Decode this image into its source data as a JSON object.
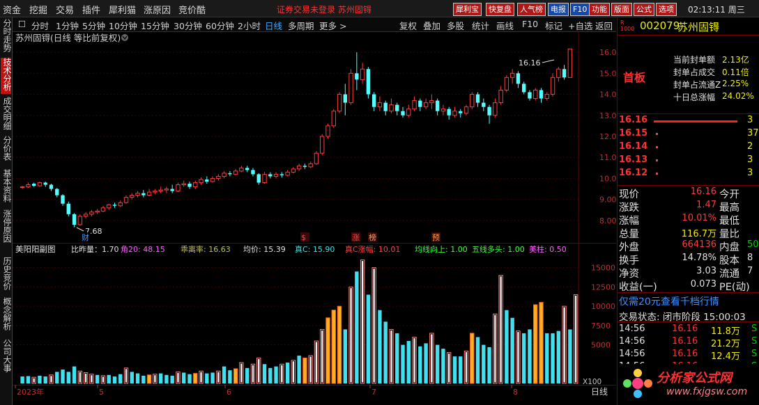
{
  "menu": {
    "items": [
      "资金",
      "挖掘",
      "交易",
      "插件",
      "犀利猫",
      "涨原因",
      "竞价酷"
    ],
    "alert": "证券交易未登录 苏州固锝",
    "tools": [
      "犀利宝",
      "快复盘",
      "人气榜",
      "电报",
      "F10",
      "功能",
      "版面",
      "公式",
      "选项"
    ],
    "clock": "02:13:11 周三"
  },
  "leftnav": [
    "分时走势",
    "技术分析",
    "成交明细",
    "分价表",
    "基本资料",
    "涨停原因",
    "历史竞价",
    "概念解析",
    "公司大事"
  ],
  "periods": [
    "分时",
    "1分钟",
    "5分钟",
    "10分钟",
    "15分钟",
    "30分钟",
    "60分钟",
    "2小时",
    "日线",
    "多周期",
    "更多 >"
  ],
  "active_period": "日线",
  "toolbar_right": [
    "复权",
    "叠加",
    "多股",
    "统计",
    "画线",
    "F10",
    "标记",
    "+自选",
    "返回"
  ],
  "chart": {
    "title": "苏州固锝(日线 等比前复权)",
    "high_label": "16.16",
    "low_label": "7.68",
    "price_ticks": [
      "16.00",
      "15.00",
      "14.00",
      "13.00",
      "12.00",
      "11.00",
      "10.00",
      "9.00",
      "8.00"
    ],
    "markers": [
      {
        "text": "财",
        "color": "#40a0ff"
      },
      {
        "text": "$",
        "color": "#ff4040"
      },
      {
        "text": "涨",
        "color": "#ff4040"
      },
      {
        "text": "榜",
        "color": "#ffa040"
      },
      {
        "text": "预",
        "color": "#ffa040"
      }
    ],
    "indicator_name": "美阳阳副图",
    "indicators": [
      {
        "text": "比昨量：1.70",
        "color": "#e0e0e0"
      },
      {
        "text": "角20: 48.15",
        "color": "#ff60ff"
      },
      {
        "text": "乖离率: 16.63",
        "color": "#c0c060"
      },
      {
        "text": "均价: 15.39",
        "color": "#e0e0e0"
      },
      {
        "text": "真C: 15.90",
        "color": "#40e0e0"
      },
      {
        "text": "真C涨幅: 10.01",
        "color": "#ff4040"
      },
      {
        "text": "均线向上: 1.00",
        "color": "#40ff40"
      },
      {
        "text": "五线多头: 1.00",
        "color": "#40ff40"
      },
      {
        "text": "美柱: 0.50",
        "color": "#ff60ff"
      }
    ],
    "volume_ticks": [
      "15000",
      "12500",
      "10000",
      "7500",
      "5000"
    ],
    "volume_unit": "X100",
    "date_labels": [
      "2023年",
      "5",
      "6",
      "7",
      "8"
    ],
    "date_right": "日线"
  },
  "chart_data": {
    "type": "candlestick",
    "price_ylim": [
      7.5,
      16.3
    ],
    "candles": [
      [
        9.6,
        9.6,
        9.5,
        9.65
      ],
      [
        9.6,
        9.7,
        9.55,
        9.8
      ],
      [
        9.75,
        9.65,
        9.6,
        9.8
      ],
      [
        9.65,
        9.8,
        9.6,
        9.85
      ],
      [
        9.8,
        9.7,
        9.6,
        9.85
      ],
      [
        9.7,
        9.5,
        9.4,
        9.75
      ],
      [
        9.5,
        9.2,
        9.1,
        9.55
      ],
      [
        9.2,
        8.8,
        8.7,
        9.25
      ],
      [
        8.8,
        8.3,
        8.2,
        8.9
      ],
      [
        8.3,
        7.8,
        7.68,
        8.35
      ],
      [
        7.8,
        8.2,
        7.75,
        8.3
      ],
      [
        8.2,
        8.3,
        8.1,
        8.4
      ],
      [
        8.3,
        8.4,
        8.2,
        8.5
      ],
      [
        8.4,
        8.45,
        8.3,
        8.55
      ],
      [
        8.45,
        8.6,
        8.4,
        8.7
      ],
      [
        8.6,
        8.75,
        8.5,
        8.8
      ],
      [
        8.75,
        8.7,
        8.6,
        8.85
      ],
      [
        8.7,
        8.85,
        8.65,
        8.95
      ],
      [
        8.85,
        9.1,
        8.8,
        9.2
      ],
      [
        9.1,
        9.2,
        9.0,
        9.3
      ],
      [
        9.2,
        9.3,
        9.1,
        9.4
      ],
      [
        9.3,
        9.2,
        9.1,
        9.45
      ],
      [
        9.2,
        9.35,
        9.15,
        9.5
      ],
      [
        9.35,
        9.4,
        9.25,
        9.5
      ],
      [
        9.4,
        9.45,
        9.3,
        9.6
      ],
      [
        9.45,
        9.5,
        9.3,
        9.6
      ],
      [
        9.5,
        9.4,
        9.3,
        9.7
      ],
      [
        9.4,
        9.7,
        9.35,
        9.8
      ],
      [
        9.7,
        9.75,
        9.6,
        9.9
      ],
      [
        9.75,
        9.6,
        9.5,
        9.85
      ],
      [
        9.6,
        9.8,
        9.5,
        9.9
      ],
      [
        9.8,
        9.95,
        9.7,
        10.05
      ],
      [
        9.95,
        9.85,
        9.75,
        10.1
      ],
      [
        9.85,
        10.0,
        9.8,
        10.1
      ],
      [
        10.0,
        10.1,
        9.9,
        10.2
      ],
      [
        10.1,
        10.25,
        10.0,
        10.35
      ],
      [
        10.25,
        10.2,
        10.1,
        10.35
      ],
      [
        10.2,
        10.35,
        10.15,
        10.45
      ],
      [
        10.35,
        10.5,
        10.3,
        10.6
      ],
      [
        10.5,
        10.4,
        10.3,
        10.6
      ],
      [
        10.4,
        10.2,
        10.1,
        10.5
      ],
      [
        10.2,
        9.8,
        9.7,
        10.25
      ],
      [
        9.8,
        10.2,
        9.75,
        10.3
      ],
      [
        10.2,
        10.1,
        10.0,
        10.3
      ],
      [
        10.1,
        10.2,
        10.0,
        10.3
      ],
      [
        10.2,
        10.15,
        10.05,
        10.3
      ],
      [
        10.15,
        10.3,
        10.1,
        10.4
      ],
      [
        10.3,
        10.45,
        10.25,
        10.55
      ],
      [
        10.45,
        10.6,
        10.35,
        10.7
      ],
      [
        10.6,
        10.55,
        10.45,
        10.7
      ],
      [
        10.55,
        10.7,
        10.5,
        10.8
      ],
      [
        10.7,
        11.2,
        10.65,
        11.3
      ],
      [
        11.2,
        12.0,
        11.1,
        12.1
      ],
      [
        12.0,
        12.5,
        11.9,
        12.6
      ],
      [
        12.5,
        13.2,
        12.4,
        13.3
      ],
      [
        13.2,
        14.0,
        13.1,
        14.1
      ],
      [
        14.0,
        13.6,
        13.0,
        14.5
      ],
      [
        13.6,
        15.0,
        13.5,
        15.2
      ],
      [
        15.0,
        14.7,
        14.2,
        16.0
      ],
      [
        14.7,
        15.2,
        14.5,
        15.5
      ],
      [
        15.2,
        14.0,
        13.8,
        15.3
      ],
      [
        14.0,
        13.4,
        13.2,
        14.1
      ],
      [
        13.4,
        13.6,
        13.2,
        13.9
      ],
      [
        13.6,
        13.2,
        13.0,
        13.7
      ],
      [
        13.2,
        13.5,
        13.1,
        13.8
      ],
      [
        13.5,
        13.2,
        13.0,
        13.6
      ],
      [
        13.2,
        13.0,
        12.9,
        13.4
      ],
      [
        13.0,
        13.3,
        12.9,
        13.5
      ],
      [
        13.3,
        13.7,
        13.2,
        13.9
      ],
      [
        13.7,
        13.4,
        13.2,
        13.8
      ],
      [
        13.4,
        13.6,
        13.3,
        13.8
      ],
      [
        13.6,
        13.7,
        13.3,
        14.0
      ],
      [
        13.7,
        13.2,
        13.0,
        13.8
      ],
      [
        13.2,
        13.3,
        13.0,
        13.5
      ],
      [
        13.3,
        13.0,
        12.8,
        13.4
      ],
      [
        13.0,
        13.2,
        12.9,
        13.4
      ],
      [
        13.2,
        13.1,
        12.9,
        13.3
      ],
      [
        13.1,
        13.4,
        13.0,
        13.5
      ],
      [
        13.4,
        14.0,
        13.3,
        14.1
      ],
      [
        14.0,
        13.6,
        13.4,
        14.1
      ],
      [
        13.6,
        13.4,
        13.2,
        13.8
      ],
      [
        13.4,
        13.0,
        12.6,
        13.5
      ],
      [
        13.0,
        13.6,
        12.9,
        13.8
      ],
      [
        13.6,
        14.2,
        13.5,
        14.4
      ],
      [
        14.2,
        14.8,
        14.1,
        14.9
      ],
      [
        14.8,
        15.0,
        14.5,
        15.2
      ],
      [
        15.0,
        14.5,
        14.3,
        15.1
      ],
      [
        14.5,
        14.1,
        14.0,
        14.6
      ],
      [
        14.1,
        13.8,
        13.7,
        14.2
      ],
      [
        13.8,
        14.2,
        13.7,
        14.3
      ],
      [
        14.2,
        13.8,
        13.6,
        14.3
      ],
      [
        13.8,
        14.0,
        13.7,
        14.1
      ],
      [
        14.0,
        14.8,
        13.9,
        15.0
      ],
      [
        14.8,
        15.2,
        14.6,
        15.3
      ],
      [
        15.2,
        14.8,
        14.7,
        15.4
      ],
      [
        14.8,
        16.16,
        14.8,
        16.16
      ]
    ],
    "volume_ylim": [
      0,
      16500
    ],
    "volumes": [
      [
        900,
        "c"
      ],
      [
        950,
        "c"
      ],
      [
        800,
        "w"
      ],
      [
        1000,
        "c"
      ],
      [
        900,
        "c"
      ],
      [
        1100,
        "w"
      ],
      [
        1500,
        "c"
      ],
      [
        1800,
        "c"
      ],
      [
        1500,
        "c"
      ],
      [
        2200,
        "c"
      ],
      [
        1600,
        "w"
      ],
      [
        1400,
        "w"
      ],
      [
        1200,
        "w"
      ],
      [
        1100,
        "c"
      ],
      [
        1000,
        "w"
      ],
      [
        1100,
        "c"
      ],
      [
        900,
        "c"
      ],
      [
        1200,
        "c"
      ],
      [
        2000,
        "w"
      ],
      [
        1500,
        "c"
      ],
      [
        1300,
        "c"
      ],
      [
        1000,
        "c"
      ],
      [
        1100,
        "o"
      ],
      [
        1200,
        "w"
      ],
      [
        1300,
        "c"
      ],
      [
        1100,
        "c"
      ],
      [
        1000,
        "c"
      ],
      [
        1500,
        "w"
      ],
      [
        1400,
        "c"
      ],
      [
        1200,
        "c"
      ],
      [
        1300,
        "o"
      ],
      [
        1600,
        "w"
      ],
      [
        1300,
        "c"
      ],
      [
        1400,
        "c"
      ],
      [
        1600,
        "w"
      ],
      [
        2200,
        "c"
      ],
      [
        1700,
        "c"
      ],
      [
        1900,
        "o"
      ],
      [
        2700,
        "w"
      ],
      [
        2000,
        "c"
      ],
      [
        2500,
        "w"
      ],
      [
        3300,
        "w"
      ],
      [
        2500,
        "c"
      ],
      [
        2000,
        "c"
      ],
      [
        2200,
        "c"
      ],
      [
        2500,
        "w"
      ],
      [
        2700,
        "c"
      ],
      [
        3000,
        "w"
      ],
      [
        3600,
        "c"
      ],
      [
        3300,
        "o"
      ],
      [
        3600,
        "w"
      ],
      [
        5500,
        "w"
      ],
      [
        7000,
        "w"
      ],
      [
        8500,
        "o"
      ],
      [
        9500,
        "o"
      ],
      [
        10000,
        "o"
      ],
      [
        7000,
        "c"
      ],
      [
        12500,
        "w"
      ],
      [
        14500,
        "c"
      ],
      [
        16000,
        "w"
      ],
      [
        11500,
        "c"
      ],
      [
        15000,
        "w"
      ],
      [
        9500,
        "c"
      ],
      [
        8000,
        "c"
      ],
      [
        7000,
        "w"
      ],
      [
        6500,
        "c"
      ],
      [
        5000,
        "c"
      ],
      [
        5500,
        "c"
      ],
      [
        6000,
        "w"
      ],
      [
        4800,
        "c"
      ],
      [
        5200,
        "c"
      ],
      [
        6500,
        "w"
      ],
      [
        5000,
        "c"
      ],
      [
        4500,
        "c"
      ],
      [
        4000,
        "w"
      ],
      [
        3500,
        "c"
      ],
      [
        3500,
        "c"
      ],
      [
        4200,
        "w"
      ],
      [
        6500,
        "o"
      ],
      [
        6000,
        "c"
      ],
      [
        5000,
        "c"
      ],
      [
        4700,
        "c"
      ],
      [
        9000,
        "w"
      ],
      [
        14000,
        "w"
      ],
      [
        9500,
        "c"
      ],
      [
        8500,
        "c"
      ],
      [
        6800,
        "w"
      ],
      [
        6500,
        "c"
      ],
      [
        7000,
        "c"
      ],
      [
        10200,
        "o"
      ],
      [
        10500,
        "o"
      ],
      [
        6500,
        "c"
      ],
      [
        6500,
        "c"
      ],
      [
        6800,
        "c"
      ],
      [
        10000,
        "w"
      ],
      [
        7000,
        "c"
      ],
      [
        11500,
        "w"
      ]
    ]
  },
  "stock": {
    "code": "002079",
    "name": "苏州固锝",
    "badge": "首板",
    "seal_stats": [
      {
        "label": "当前封单额",
        "value": "2.13亿"
      },
      {
        "label": "封单占成交",
        "value": "0.11倍"
      },
      {
        "label": "封单占流通Z",
        "value": "2.25%"
      },
      {
        "label": "十日总涨幅",
        "value": "24.02%"
      }
    ],
    "order_book": [
      {
        "price": "16.16",
        "vol": "3"
      },
      {
        "price": "16.15",
        "vol": "37"
      },
      {
        "price": "16.14",
        "vol": "2"
      },
      {
        "price": "16.13",
        "vol": "3"
      },
      {
        "price": "16.12",
        "vol": "3"
      }
    ],
    "quote": [
      {
        "l1": "现价",
        "v1": "16.16",
        "c1": "red",
        "l2": "今开"
      },
      {
        "l1": "涨跌",
        "v1": "1.47",
        "c1": "red",
        "l2": "最高"
      },
      {
        "l1": "涨幅",
        "v1": "10.01%",
        "c1": "red",
        "l2": "最低"
      },
      {
        "l1": "总量",
        "v1": "116.7万",
        "c1": "yel",
        "l2": "量比"
      },
      {
        "l1": "外盘",
        "v1": "664136",
        "c1": "red",
        "l2": "内盘",
        "v2": "50",
        "c2": "grn"
      },
      {
        "l1": "换手",
        "v1": "14.78%",
        "c1": "lbl",
        "l2": "股本",
        "v2": "8",
        "c2": "lbl"
      },
      {
        "l1": "净资",
        "v1": "3.03",
        "c1": "lbl",
        "l2": "流通",
        "v2": "7",
        "c2": "lbl"
      },
      {
        "l1": "收益(一)",
        "v1": "0.073",
        "c1": "lbl",
        "l2": "PE(动)"
      }
    ],
    "promo": "仅需20元查看千档行情",
    "trade_status": "交易状态: 闭市阶段 15:00:03",
    "ticks": [
      {
        "time": "14:56",
        "price": "16.16",
        "vol": "11.8万",
        "flag": "S"
      },
      {
        "time": "14:56",
        "price": "16.16",
        "vol": "21.2万",
        "flag": "S"
      },
      {
        "time": "14:56",
        "price": "16.16",
        "vol": "12.4万",
        "flag": "S"
      },
      {
        "time": "14:56",
        "price": "16.16",
        "vol": "10.1万",
        "flag": "S"
      }
    ],
    "logo": "分析家公式网",
    "logo_url": "www.fxjgsw.com"
  }
}
